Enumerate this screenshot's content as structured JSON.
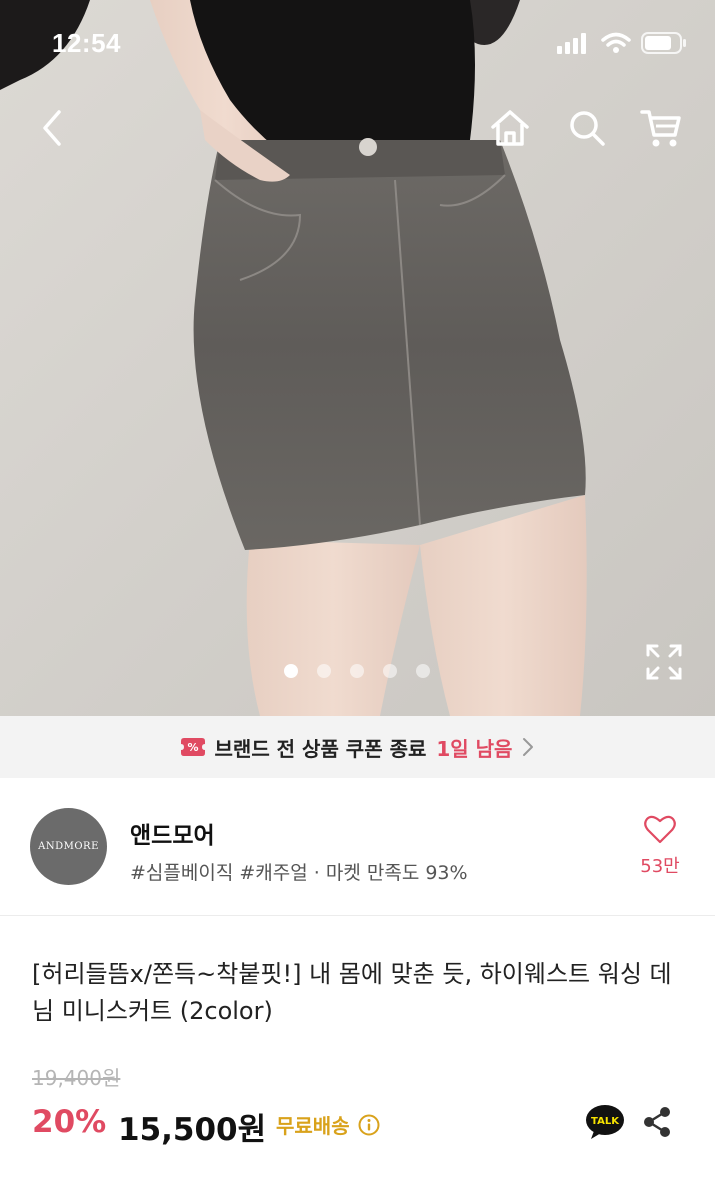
{
  "status_bar": {
    "time": "12:54"
  },
  "hero": {
    "slide_count": 5,
    "active_slide": 1
  },
  "icons": {
    "back": "chevron-left-icon",
    "home": "home-icon",
    "search": "search-icon",
    "cart": "cart-icon",
    "expand": "expand-icon",
    "coupon": "coupon-icon",
    "heart": "heart-icon",
    "info": "info-icon",
    "talk": "kakao-talk-icon",
    "share": "share-icon"
  },
  "coupon_banner": {
    "text": "브랜드 전 상품 쿠폰 종료",
    "highlight": "1일 남음"
  },
  "brand": {
    "logo_text": "ANDMORE",
    "name": "앤드모어",
    "tags": "#심플베이직 #캐주얼",
    "satisfaction": "· 마켓 만족도 93%",
    "likes": "53만"
  },
  "product": {
    "title": "[허리들뜸x/쫀득~착붙핏!] 내 몸에 맞춘 듯, 하이웨스트 워싱 데님 미니스커트 (2color)",
    "original_price": "19,400원",
    "discount": "20%",
    "price": "15,500원",
    "shipping": "무료배송",
    "talk_label": "TALK"
  },
  "colors": {
    "accent": "#e04a62",
    "shipping": "#d9a21b"
  }
}
